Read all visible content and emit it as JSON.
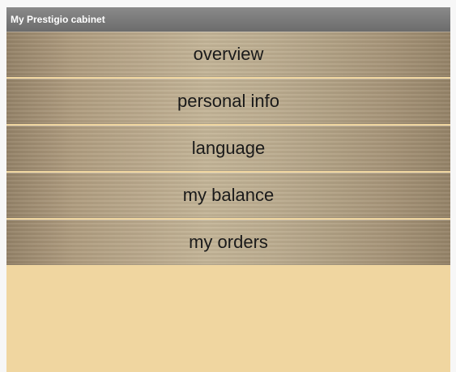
{
  "window": {
    "title": "My Prestigio cabinet"
  },
  "menu": {
    "items": [
      {
        "label": "overview"
      },
      {
        "label": "personal info"
      },
      {
        "label": "language"
      },
      {
        "label": "my balance"
      },
      {
        "label": "my orders"
      }
    ]
  },
  "colors": {
    "titlebar": "#777777",
    "button": "#b8a78a",
    "background": "#f0d6a0",
    "text": "#1a1a1a"
  }
}
